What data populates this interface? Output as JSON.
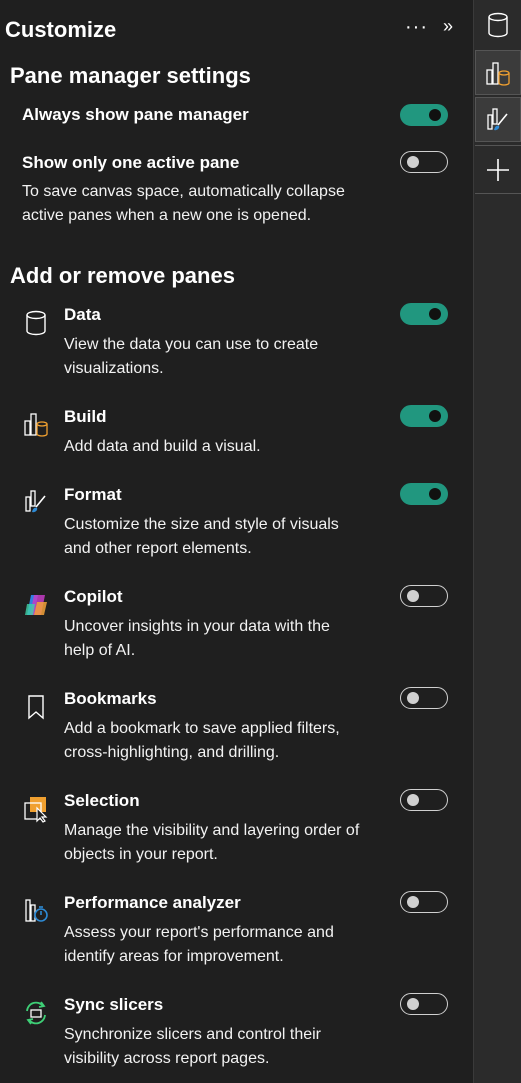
{
  "header": {
    "title": "Customize",
    "more_label": "···",
    "collapse_label": "»"
  },
  "pane_manager": {
    "heading": "Pane manager settings",
    "always_show": {
      "label": "Always show pane manager",
      "on": true
    },
    "one_active": {
      "label": "Show only one active pane",
      "on": false,
      "desc1": "To save canvas space, automatically collapse",
      "desc2": "active panes when a new one is opened."
    }
  },
  "panes_section": {
    "heading": "Add or remove panes",
    "items": [
      {
        "icon": "data-cylinder-icon",
        "label": "Data",
        "on": true,
        "desc1": "View the data you can use to create",
        "desc2": "visualizations."
      },
      {
        "icon": "build-visual-icon",
        "label": "Build",
        "on": true,
        "desc1": "Add data and build a visual.",
        "desc2": ""
      },
      {
        "icon": "format-brush-icon",
        "label": "Format",
        "on": true,
        "desc1": "Customize the size and style of visuals",
        "desc2": "and other report elements."
      },
      {
        "icon": "copilot-icon",
        "label": "Copilot",
        "on": false,
        "desc1": "Uncover insights in your data with the",
        "desc2": "help of AI."
      },
      {
        "icon": "bookmark-icon",
        "label": "Bookmarks",
        "on": false,
        "desc1": "Add a bookmark to save applied filters,",
        "desc2": "cross-highlighting, and drilling."
      },
      {
        "icon": "selection-icon",
        "label": "Selection",
        "on": false,
        "desc1": "Manage the visibility and layering order of",
        "desc2": "objects in your report."
      },
      {
        "icon": "performance-analyzer-icon",
        "label": "Performance analyzer",
        "on": false,
        "desc1": "Assess your report's performance and",
        "desc2": "identify areas for improvement."
      },
      {
        "icon": "sync-slicers-icon",
        "label": "Sync slicers",
        "on": false,
        "desc1": "Synchronize slicers and control their",
        "desc2": "visibility across report pages."
      }
    ]
  },
  "rail": {
    "buttons": [
      "data-cylinder-icon",
      "build-visual-icon",
      "format-brush-icon",
      "add-pane-icon"
    ]
  },
  "colors": {
    "toggle_on": "#21977f",
    "accent_orange": "#f0a030",
    "background": "#1f1f1f"
  }
}
